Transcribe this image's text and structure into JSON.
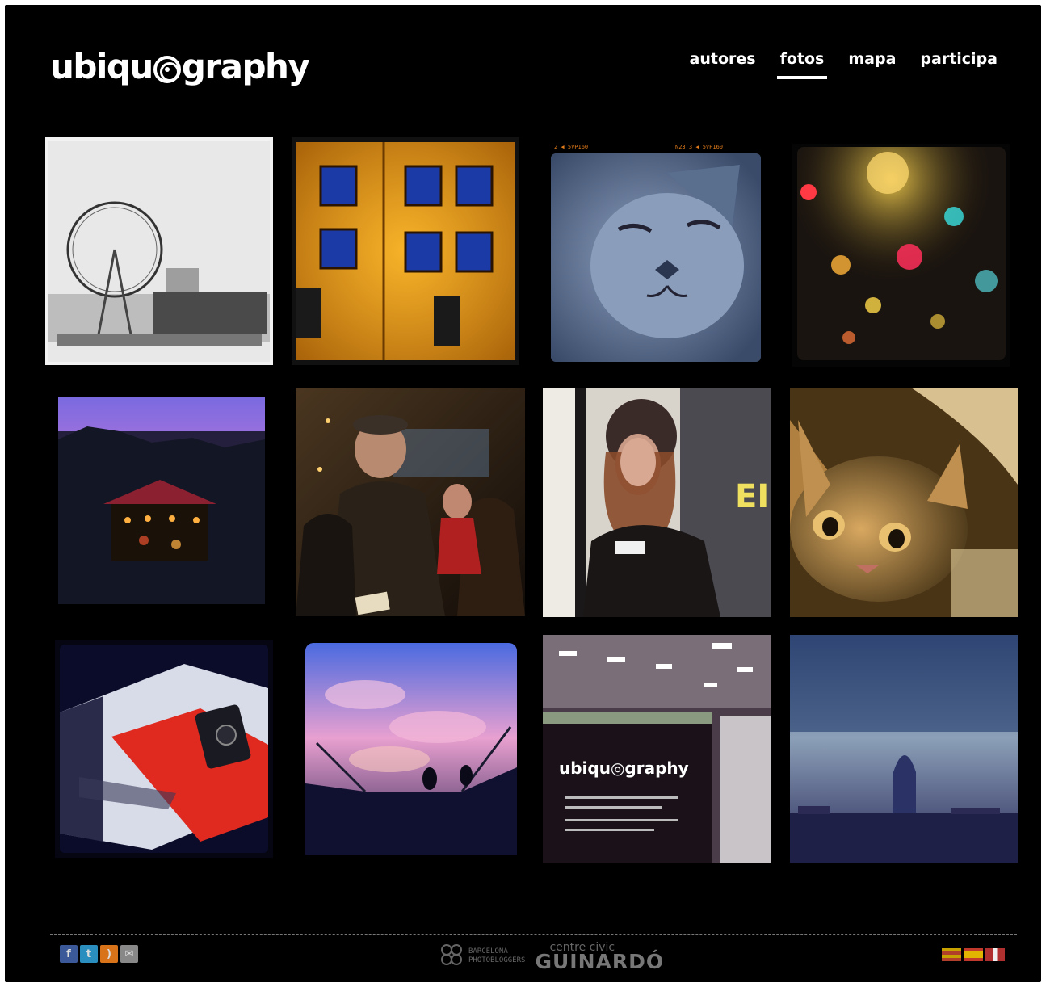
{
  "brand": {
    "logo_left": "ubiqu",
    "logo_right": "graphy"
  },
  "nav": [
    {
      "label": "autores",
      "active": false
    },
    {
      "label": "fotos",
      "active": true
    },
    {
      "label": "mapa",
      "active": false
    },
    {
      "label": "participa",
      "active": false
    }
  ],
  "photos": [
    {
      "subject": "London Eye black and white"
    },
    {
      "subject": "Orange building facade with blue windows"
    },
    {
      "subject": "Sleeping cat closeup"
    },
    {
      "subject": "Night city lights bokeh through rain"
    },
    {
      "subject": "Carousel under purple sunset sky"
    },
    {
      "subject": "Elderly man in cap on street at night"
    },
    {
      "subject": "Girl in hoodie looking at phone"
    },
    {
      "subject": "Tabby cat resting"
    },
    {
      "subject": "Camera on red cloth"
    },
    {
      "subject": "Stairs under pink clouds with silhouette"
    },
    {
      "subject": "Laptop screen showing ubiquography in office"
    },
    {
      "subject": "Torre Agbar skyline in blue fog"
    }
  ],
  "footer": {
    "social": [
      {
        "icon": "facebook-icon",
        "glyph": "f",
        "color": "#3b5998"
      },
      {
        "icon": "twitter-icon",
        "glyph": "t",
        "color": "#2a8fbf"
      },
      {
        "icon": "rss-icon",
        "glyph": ")",
        "color": "#d9731a"
      },
      {
        "icon": "email-icon",
        "glyph": "✉",
        "color": "#888888"
      }
    ],
    "sponsor1_line1": "BARCELONA",
    "sponsor1_line2": "PHOTOBLOGGERS",
    "sponsor2_small": "centre civic",
    "sponsor2_big": "GUINARDÓ",
    "flags": [
      {
        "lang": "catalan",
        "colors": [
          "#c8a300",
          "#b0402a"
        ]
      },
      {
        "lang": "spanish",
        "colors": [
          "#c0392b",
          "#e0b400"
        ]
      },
      {
        "lang": "english",
        "colors": [
          "#b03030",
          "#f0f0f0"
        ]
      }
    ]
  }
}
